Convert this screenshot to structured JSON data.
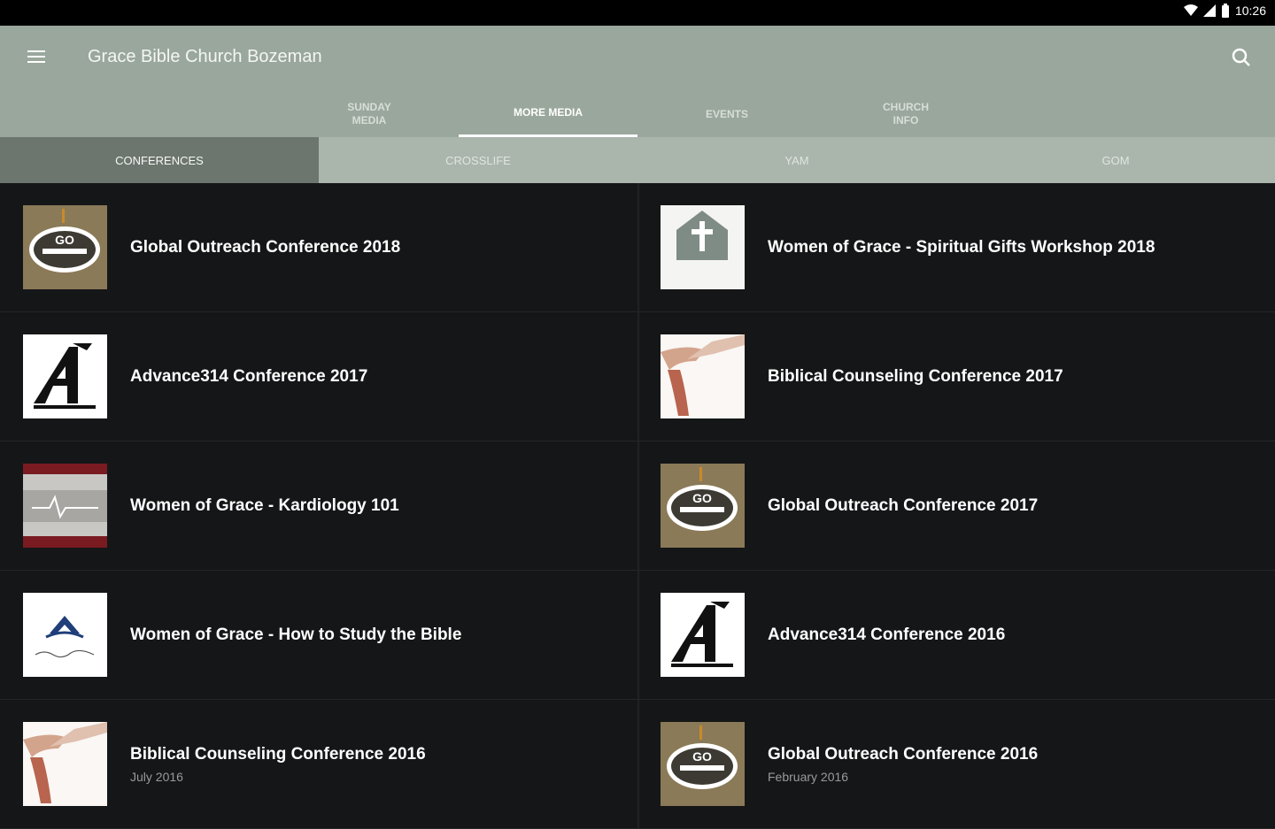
{
  "status": {
    "time": "10:26"
  },
  "app": {
    "title": "Grace Bible Church Bozeman"
  },
  "tabs": [
    {
      "label": "SUNDAY\nMEDIA"
    },
    {
      "label": "MORE MEDIA"
    },
    {
      "label": "EVENTS"
    },
    {
      "label": "CHURCH\nINFO"
    }
  ],
  "subtabs": [
    {
      "label": "CONFERENCES"
    },
    {
      "label": "CROSSLIFE"
    },
    {
      "label": "YAM"
    },
    {
      "label": "GOM"
    }
  ],
  "items": [
    {
      "title": "Global Outreach Conference 2018",
      "sub": "",
      "thumb": "go-logo"
    },
    {
      "title": "Women of Grace - Spiritual Gifts Workshop 2018",
      "sub": "",
      "thumb": "grace-house-logo"
    },
    {
      "title": "Advance314 Conference 2017",
      "sub": "",
      "thumb": "advance-logo"
    },
    {
      "title": "Biblical Counseling Conference 2017",
      "sub": "",
      "thumb": "hands-logo"
    },
    {
      "title": "Women of Grace - Kardiology 101",
      "sub": "",
      "thumb": "kardiology-logo"
    },
    {
      "title": "Global Outreach Conference 2017",
      "sub": "",
      "thumb": "go-logo"
    },
    {
      "title": "Women of Grace - How to Study the Bible",
      "sub": "",
      "thumb": "women-grace-logo"
    },
    {
      "title": "Advance314 Conference 2016",
      "sub": "",
      "thumb": "advance-logo"
    },
    {
      "title": "Biblical Counseling Conference 2016",
      "sub": "July 2016",
      "thumb": "hands-logo"
    },
    {
      "title": "Global Outreach Conference 2016",
      "sub": "February 2016",
      "thumb": "go-logo"
    }
  ]
}
